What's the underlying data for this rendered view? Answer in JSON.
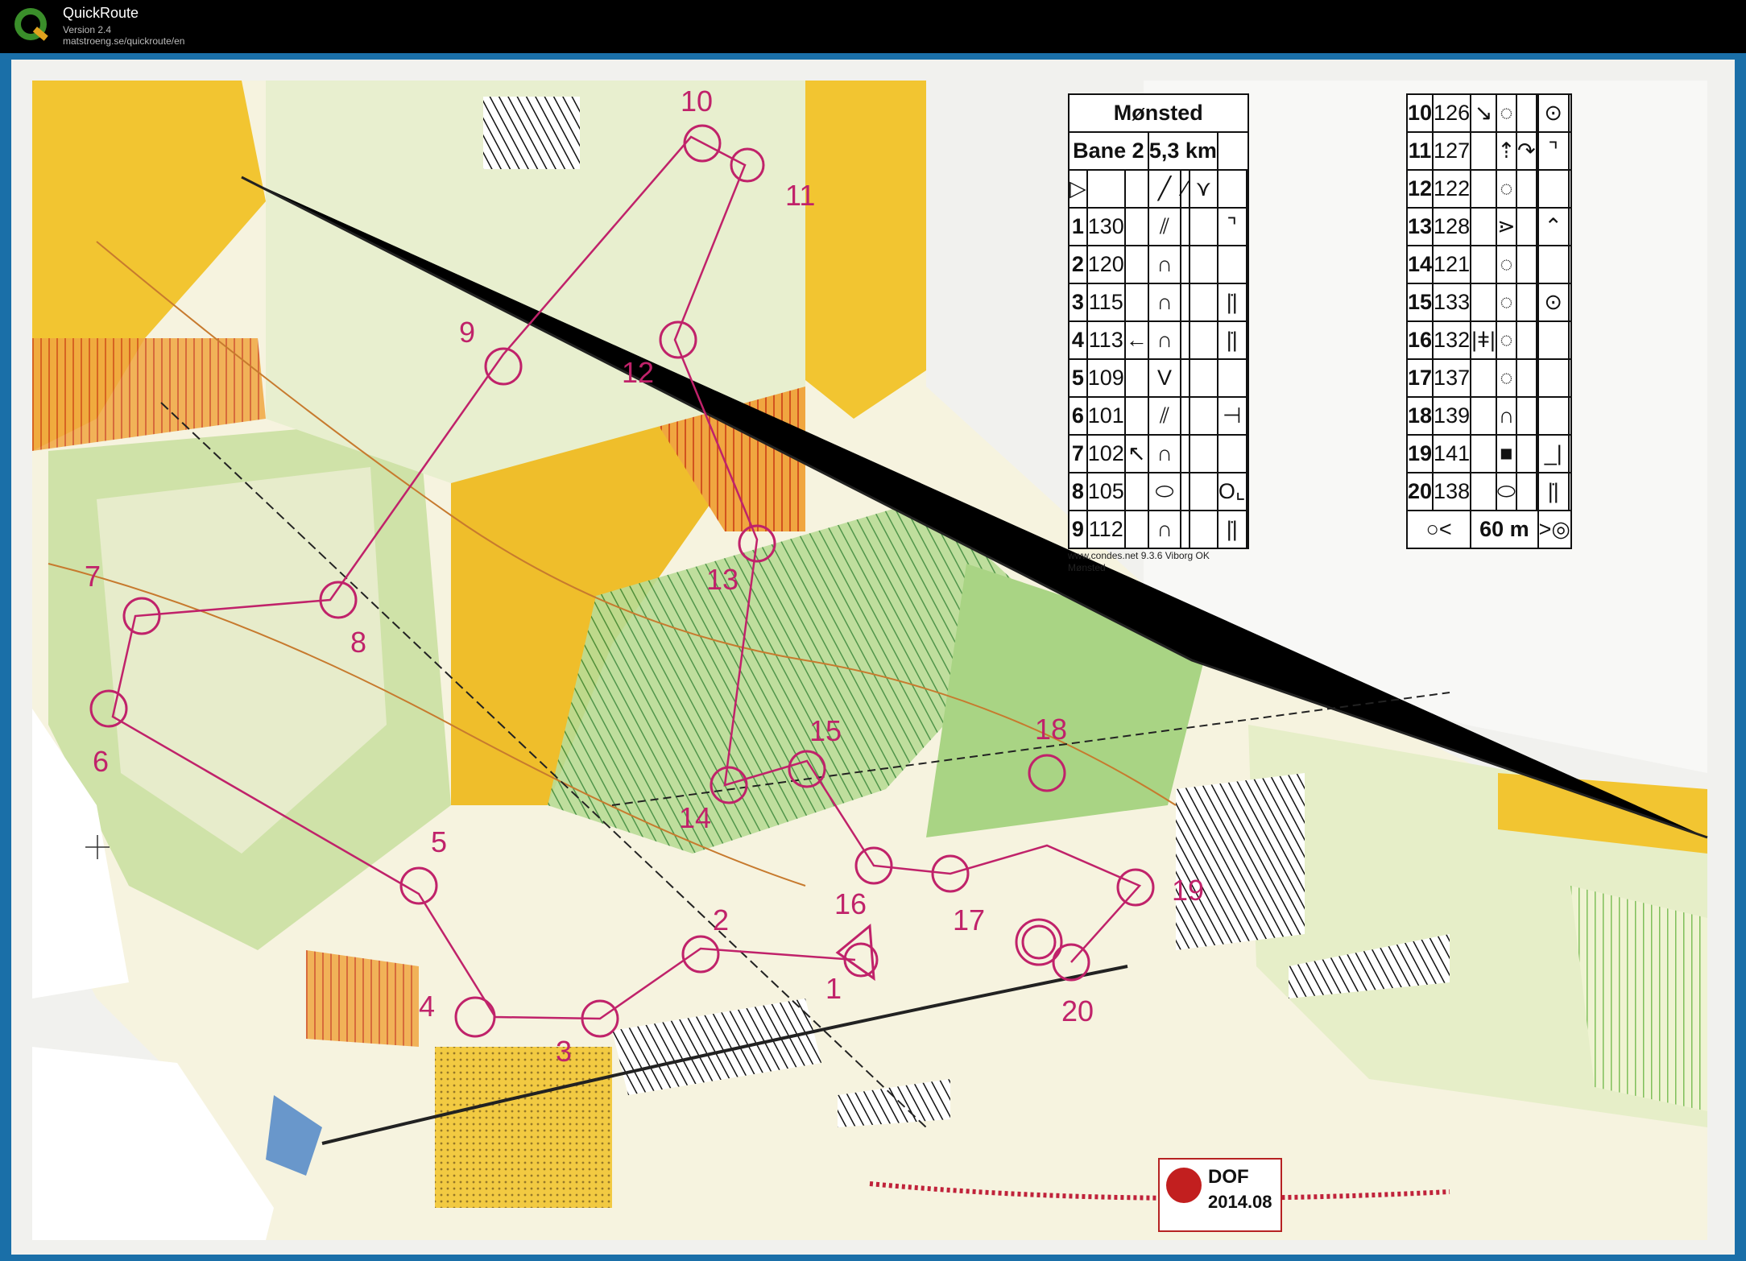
{
  "app": {
    "name": "QuickRoute",
    "version": "Version 2.4",
    "url": "matstroeng.se/quickroute/en"
  },
  "map": {
    "event_name": "Mønsted",
    "course_name": "Bane 2",
    "course_length": "5,3 km",
    "finish_distance": "60 m",
    "source_line1": "www.condes.net 9.3.6 Viborg OK",
    "source_line2": "Mønsted",
    "dof_label": "DOF",
    "dof_date": "2014.08",
    "controls": [
      {
        "label": "1"
      },
      {
        "label": "2"
      },
      {
        "label": "3"
      },
      {
        "label": "4"
      },
      {
        "label": "5"
      },
      {
        "label": "6"
      },
      {
        "label": "7"
      },
      {
        "label": "8"
      },
      {
        "label": "9"
      },
      {
        "label": "10"
      },
      {
        "label": "11"
      },
      {
        "label": "12"
      },
      {
        "label": "13"
      },
      {
        "label": "14"
      },
      {
        "label": "15"
      },
      {
        "label": "16"
      },
      {
        "label": "17"
      },
      {
        "label": "18"
      },
      {
        "label": "19"
      },
      {
        "label": "20"
      }
    ],
    "descriptions_left": [
      {
        "n": "1",
        "code": "130"
      },
      {
        "n": "2",
        "code": "120"
      },
      {
        "n": "3",
        "code": "115"
      },
      {
        "n": "4",
        "code": "113"
      },
      {
        "n": "5",
        "code": "109"
      },
      {
        "n": "6",
        "code": "101"
      },
      {
        "n": "7",
        "code": "102"
      },
      {
        "n": "8",
        "code": "105"
      },
      {
        "n": "9",
        "code": "112"
      }
    ],
    "descriptions_right": [
      {
        "n": "10",
        "code": "126"
      },
      {
        "n": "11",
        "code": "127"
      },
      {
        "n": "12",
        "code": "122"
      },
      {
        "n": "13",
        "code": "128"
      },
      {
        "n": "14",
        "code": "121"
      },
      {
        "n": "15",
        "code": "133"
      },
      {
        "n": "16",
        "code": "132"
      },
      {
        "n": "17",
        "code": "137"
      },
      {
        "n": "18",
        "code": "139"
      },
      {
        "n": "19",
        "code": "141"
      },
      {
        "n": "20",
        "code": "138"
      }
    ],
    "colors": {
      "frame": "#1a6fa8",
      "course": "#c0226a",
      "forest": "#ffffff",
      "open": "#f2c531",
      "rough": "#e8d78a",
      "green": "#8fc46a",
      "dark_green": "#5aa34a",
      "contour": "#c77a2e",
      "orange_hatch": "#e07a24"
    }
  }
}
